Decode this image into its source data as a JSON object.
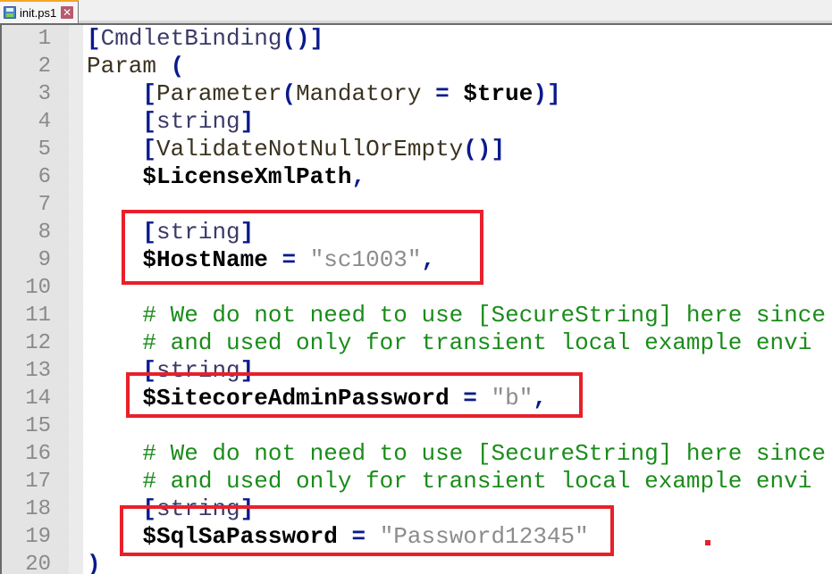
{
  "tab": {
    "filename": "init.ps1",
    "icon": "save-icon",
    "close_icon": "close-icon",
    "accent_color": "#f5a623"
  },
  "editor": {
    "lines": [
      {
        "n": "1",
        "tokens": [
          [
            "br",
            "["
          ],
          [
            "ty",
            "CmdletBinding"
          ],
          [
            "br",
            "()]"
          ]
        ]
      },
      {
        "n": "2",
        "tokens": [
          [
            "kw",
            "Param "
          ],
          [
            "br",
            "("
          ]
        ]
      },
      {
        "n": "3",
        "tokens": [
          [
            "sp",
            "    "
          ],
          [
            "br",
            "["
          ],
          [
            "kw",
            "Parameter"
          ],
          [
            "br",
            "("
          ],
          [
            "kw",
            "Mandatory "
          ],
          [
            "op",
            "="
          ],
          [
            "kw",
            " "
          ],
          [
            "var",
            "$true"
          ],
          [
            "br",
            ")]"
          ]
        ]
      },
      {
        "n": "4",
        "tokens": [
          [
            "sp",
            "    "
          ],
          [
            "br",
            "["
          ],
          [
            "ty",
            "string"
          ],
          [
            "br",
            "]"
          ]
        ]
      },
      {
        "n": "5",
        "tokens": [
          [
            "sp",
            "    "
          ],
          [
            "br",
            "["
          ],
          [
            "kw",
            "ValidateNotNullOrEmpty"
          ],
          [
            "br",
            "()]"
          ]
        ]
      },
      {
        "n": "6",
        "tokens": [
          [
            "sp",
            "    "
          ],
          [
            "var",
            "$LicenseXmlPath"
          ],
          [
            "op",
            ","
          ]
        ]
      },
      {
        "n": "7",
        "tokens": []
      },
      {
        "n": "8",
        "tokens": [
          [
            "sp",
            "    "
          ],
          [
            "br",
            "["
          ],
          [
            "ty",
            "string"
          ],
          [
            "br",
            "]"
          ]
        ]
      },
      {
        "n": "9",
        "tokens": [
          [
            "sp",
            "    "
          ],
          [
            "var",
            "$HostName"
          ],
          [
            "kw",
            " "
          ],
          [
            "op",
            "="
          ],
          [
            "kw",
            " "
          ],
          [
            "str",
            "\"sc1003\""
          ],
          [
            "op",
            ","
          ]
        ]
      },
      {
        "n": "10",
        "tokens": []
      },
      {
        "n": "11",
        "tokens": [
          [
            "sp",
            "    "
          ],
          [
            "cm",
            "# We do not need to use [SecureString] here since"
          ]
        ]
      },
      {
        "n": "12",
        "tokens": [
          [
            "sp",
            "    "
          ],
          [
            "cm",
            "# and used only for transient local example envi"
          ]
        ]
      },
      {
        "n": "13",
        "tokens": [
          [
            "sp",
            "    "
          ],
          [
            "br",
            "["
          ],
          [
            "ty",
            "string"
          ],
          [
            "br",
            "]"
          ]
        ]
      },
      {
        "n": "14",
        "tokens": [
          [
            "sp",
            "    "
          ],
          [
            "var",
            "$SitecoreAdminPassword"
          ],
          [
            "kw",
            " "
          ],
          [
            "op",
            "="
          ],
          [
            "kw",
            " "
          ],
          [
            "str",
            "\"b\""
          ],
          [
            "op",
            ","
          ]
        ]
      },
      {
        "n": "15",
        "tokens": []
      },
      {
        "n": "16",
        "tokens": [
          [
            "sp",
            "    "
          ],
          [
            "cm",
            "# We do not need to use [SecureString] here since"
          ]
        ]
      },
      {
        "n": "17",
        "tokens": [
          [
            "sp",
            "    "
          ],
          [
            "cm",
            "# and used only for transient local example envi"
          ]
        ]
      },
      {
        "n": "18",
        "tokens": [
          [
            "sp",
            "    "
          ],
          [
            "br",
            "["
          ],
          [
            "ty",
            "string"
          ],
          [
            "br",
            "]"
          ]
        ]
      },
      {
        "n": "19",
        "tokens": [
          [
            "sp",
            "    "
          ],
          [
            "var",
            "$SqlSaPassword"
          ],
          [
            "kw",
            " "
          ],
          [
            "op",
            "="
          ],
          [
            "kw",
            " "
          ],
          [
            "str",
            "\"Password12345\""
          ]
        ]
      },
      {
        "n": "20",
        "tokens": [
          [
            "br",
            ")"
          ]
        ]
      }
    ]
  },
  "annotations": {
    "highlight_color": "#e8202a",
    "boxes": [
      {
        "name": "highlight-hostname",
        "lines": [
          "8",
          "9"
        ]
      },
      {
        "name": "highlight-sitecore-admin-password",
        "lines": [
          "14"
        ]
      },
      {
        "name": "highlight-sql-sa-password",
        "lines": [
          "19"
        ]
      }
    ]
  }
}
